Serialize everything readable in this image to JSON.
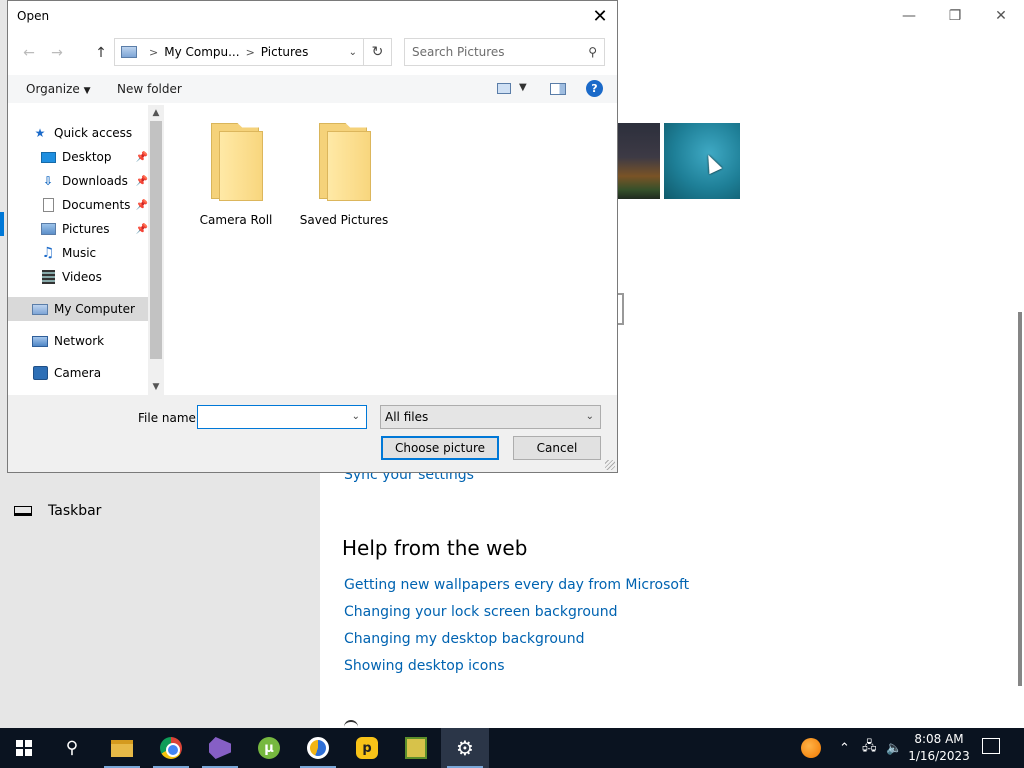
{
  "settings": {
    "nav_taskbar_label": "Taskbar",
    "sync_link": "Sync your settings",
    "help_title": "Help from the web",
    "help_links": [
      "Getting new wallpapers every day from Microsoft",
      "Changing your lock screen background",
      "Changing my desktop background",
      "Showing desktop icons"
    ]
  },
  "dialog": {
    "title": "Open",
    "address": {
      "segment_1": "My Compu...",
      "segment_2": "Pictures"
    },
    "search_placeholder": "Search Pictures",
    "toolbar": {
      "organize": "Organize",
      "new_folder": "New folder"
    },
    "nav_items": [
      {
        "label": "Quick access",
        "icon": "star-icon"
      },
      {
        "label": "Desktop",
        "icon": "desktop-icon",
        "pinned": true
      },
      {
        "label": "Downloads",
        "icon": "download-icon",
        "pinned": true
      },
      {
        "label": "Documents",
        "icon": "document-icon",
        "pinned": true
      },
      {
        "label": "Pictures",
        "icon": "pictures-icon",
        "pinned": true
      },
      {
        "label": "Music",
        "icon": "music-icon"
      },
      {
        "label": "Videos",
        "icon": "video-icon"
      },
      {
        "label": "My Computer",
        "icon": "computer-icon",
        "selected": true
      },
      {
        "label": "Network",
        "icon": "network-icon"
      },
      {
        "label": "Camera",
        "icon": "camera-icon"
      }
    ],
    "folders": [
      {
        "label": "Camera Roll"
      },
      {
        "label": "Saved Pictures"
      }
    ],
    "file_name_label": "File name:",
    "file_name_value": "",
    "file_type": "All files",
    "choose_button": "Choose picture",
    "cancel_button": "Cancel"
  },
  "taskbar": {
    "time": "8:08 AM",
    "date": "1/16/2023"
  },
  "colors": {
    "accent": "#0078d7",
    "link": "#0063b1",
    "taskbar": "#0a1320"
  }
}
